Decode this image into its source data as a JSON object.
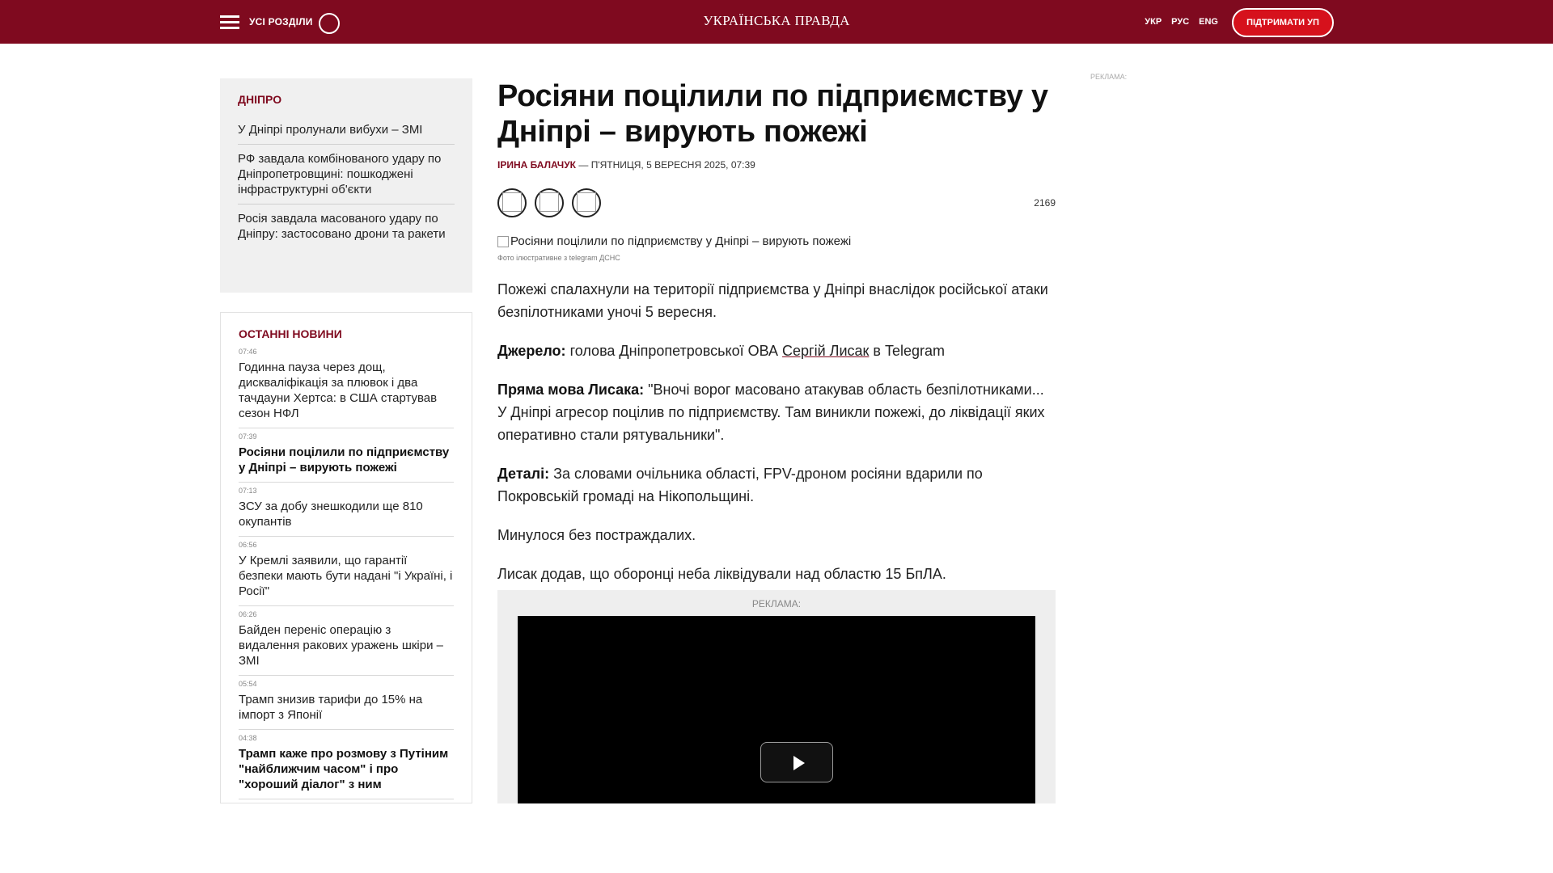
{
  "header": {
    "menu_label": "УСІ РОЗДІЛИ",
    "logo": "УКРАЇНСЬКА ПРАВДА",
    "languages": [
      "УКР",
      "РУС",
      "ENG"
    ],
    "support_label": "ПІДТРИМАТИ УП"
  },
  "dnipro": {
    "title": "ДНІПРО",
    "items": [
      "У Дніпрі пролунали вибухи – ЗМІ",
      "РФ завдала комбінованого удару по Дніпропетровщині: пошкоджені інфраструктурні об'єкти",
      "Росія завдала масованого удару по Дніпру: застосовано дрони та ракети"
    ]
  },
  "latest": {
    "title": "ОСТАННІ НОВИНИ",
    "items": [
      {
        "time": "07:46",
        "title": "Годинна пауза через дощ, дискваліфікація за плювок і два тачдауни Хертса: в США стартував сезон НФЛ",
        "bold": false
      },
      {
        "time": "07:39",
        "title": "Росіяни поцілили по підприємству у Дніпрі – вирують пожежі",
        "bold": true
      },
      {
        "time": "07:13",
        "title": "ЗСУ за добу знешкодили ще 810 окупантів",
        "bold": false
      },
      {
        "time": "06:56",
        "title": "У Кремлі заявили, що гарантії безпеки мають бути надані \"і Україні, і Росії\"",
        "bold": false
      },
      {
        "time": "06:26",
        "title": "Байден переніс операцію з видалення ракових уражень шкіри – ЗМІ",
        "bold": false
      },
      {
        "time": "05:54",
        "title": "Трамп знизив тарифи до 15% на імпорт з Японії",
        "bold": false
      },
      {
        "time": "04:38",
        "title": "Трамп каже про розмову з Путіним \"найближчим часом\" і про \"хороший діалог\" з ним",
        "bold": true
      }
    ]
  },
  "article": {
    "headline": "Росіяни поцілили по підприємству у Дніпрі – вирують пожежі",
    "author": "ІРИНА БАЛАЧУК",
    "separator": " — ",
    "date": "П'ЯТНИЦЯ, 5 ВЕРЕСНЯ 2025, 07:39",
    "views": "2169",
    "photo_alt": "Росіяни поцілили по підприємству у Дніпрі – вирують пожежі",
    "photo_caption": "Фото ілюстративне з telegram ДСНС",
    "p1": "Пожежі спалахнули на території підприємства у Дніпрі внаслідок російської атаки безпілотниками уночі 5 вересня.",
    "p2_label": "Джерело:",
    "p2_text": " голова Дніпропетровської ОВА ",
    "p2_link": "Сергій Лисак",
    "p2_tail": " в Telegram",
    "p3_label": "Пряма мова Лисака:",
    "p3_text": " \"Вночі ворог масовано атакував область безпілотниками... У Дніпрі агресор поцілив по підприємству. Там виникли пожежі, до ліквідації яких оперативно стали рятувальники\".",
    "p4_label": "Деталі:",
    "p4_text": " За словами очільника області, FPV-дроном росіяни вдарили по Покровській громаді на Нікопольщині.",
    "p5": "Минулося без постраждалих.",
    "p6": "Лисак додав, що оборонці неба ліквідували над областю 15 БпЛА."
  },
  "ads": {
    "label_inline": "РЕКЛАМА:",
    "label_right": "РЕКЛАМА:"
  }
}
